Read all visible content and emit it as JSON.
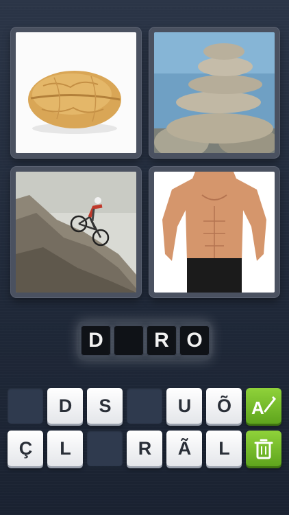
{
  "puzzle": {
    "pictures": [
      {
        "subject": "walnut"
      },
      {
        "subject": "stacked stones"
      },
      {
        "subject": "mountain biker on rock"
      },
      {
        "subject": "muscular torso"
      }
    ],
    "answer_slots": [
      "D",
      "",
      "R",
      "O"
    ],
    "letter_row_1": [
      "",
      "D",
      "S",
      "",
      "U",
      "Õ"
    ],
    "letter_row_2": [
      "Ç",
      "L",
      "",
      "R",
      "Ã",
      "L"
    ]
  },
  "actions": {
    "hint_icon": "letter-a-with-wand-icon",
    "remove_icon": "trash-can-icon"
  },
  "colors": {
    "background": "#222b3b",
    "action_green": "#76bd2b",
    "tile": "#f2f3f5"
  }
}
